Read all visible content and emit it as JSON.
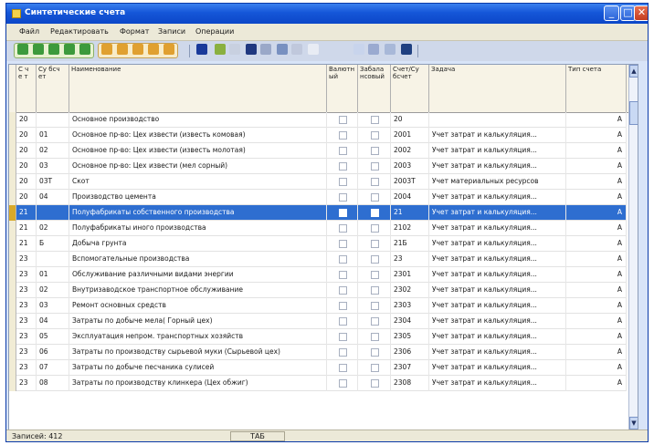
{
  "window": {
    "title": "Синтетические счета",
    "controls": [
      "_",
      "□",
      "✕"
    ]
  },
  "menu": [
    "Файл",
    "Редактировать",
    "Формат",
    "Записи",
    "Операции"
  ],
  "columns": [
    {
      "label": "С ч е т",
      "key": "acct"
    },
    {
      "label": "Су бсч ет",
      "key": "sub"
    },
    {
      "label": "Наименование",
      "key": "name"
    },
    {
      "label": "Валютн ый",
      "key": "val"
    },
    {
      "label": "Забала нсовый",
      "key": "off"
    },
    {
      "label": "Счет/Су бсчет",
      "key": "code"
    },
    {
      "label": "Задача",
      "key": "task"
    },
    {
      "label": "Тип счета",
      "key": "type"
    }
  ],
  "rows": [
    {
      "acct": "20",
      "sub": "",
      "name": "Основное производство",
      "code": "20",
      "task": "",
      "type": "А"
    },
    {
      "acct": "20",
      "sub": "01",
      "name": "Основное пр-во: Цех извести (известь комовая)",
      "code": "2001",
      "task": "Учет затрат и калькуляция...",
      "type": "А"
    },
    {
      "acct": "20",
      "sub": "02",
      "name": "Основное пр-во: Цех извести (известь молотая)",
      "code": "2002",
      "task": "Учет затрат и калькуляция...",
      "type": "А"
    },
    {
      "acct": "20",
      "sub": "03",
      "name": "Основное пр-во: Цех извести (мел сорный)",
      "code": "2003",
      "task": "Учет затрат и калькуляция...",
      "type": "А"
    },
    {
      "acct": "20",
      "sub": "03Т",
      "name": "Скот",
      "code": "2003Т",
      "task": "Учет материальных ресурсов",
      "type": "А"
    },
    {
      "acct": "20",
      "sub": "04",
      "name": "Производство цемента",
      "code": "2004",
      "task": "Учет затрат и калькуляция...",
      "type": "А"
    },
    {
      "acct": "21",
      "sub": "",
      "name": "Полуфабрикаты собственного производства",
      "code": "21",
      "task": "Учет затрат и калькуляция...",
      "type": "А",
      "selected": true
    },
    {
      "acct": "21",
      "sub": "02",
      "name": "Полуфабрикаты иного производства",
      "code": "2102",
      "task": "Учет затрат и калькуляция...",
      "type": "А"
    },
    {
      "acct": "21",
      "sub": "Б",
      "name": "Добыча грунта",
      "code": "21Б",
      "task": "Учет затрат и калькуляция...",
      "type": "А"
    },
    {
      "acct": "23",
      "sub": "",
      "name": "Вспомогательные производства",
      "code": "23",
      "task": "Учет затрат и калькуляция...",
      "type": "А"
    },
    {
      "acct": "23",
      "sub": "01",
      "name": "Обслуживание различными видами энергии",
      "code": "2301",
      "task": "Учет затрат и калькуляция...",
      "type": "А"
    },
    {
      "acct": "23",
      "sub": "02",
      "name": "Внутризаводское транспортное обслуживание",
      "code": "2302",
      "task": "Учет затрат и калькуляция...",
      "type": "А"
    },
    {
      "acct": "23",
      "sub": "03",
      "name": "Ремонт основных средств",
      "code": "2303",
      "task": "Учет затрат и калькуляция...",
      "type": "А"
    },
    {
      "acct": "23",
      "sub": "04",
      "name": "Затраты по добыче мела( Горный цех)",
      "code": "2304",
      "task": "Учет затрат и калькуляция...",
      "type": "А"
    },
    {
      "acct": "23",
      "sub": "05",
      "name": "Эксплуатация непром. транспортных хозяйств",
      "code": "2305",
      "task": "Учет затрат и калькуляция...",
      "type": "А"
    },
    {
      "acct": "23",
      "sub": "06",
      "name": "Затраты по производству сырьевой муки (Сырьевой цех)",
      "code": "2306",
      "task": "Учет затрат и калькуляция...",
      "type": "А"
    },
    {
      "acct": "23",
      "sub": "07",
      "name": "Затраты по добыче песчаника сулисей",
      "code": "2307",
      "task": "Учет затрат и калькуляция...",
      "type": "А"
    },
    {
      "acct": "23",
      "sub": "08",
      "name": "Затраты по производству клинкера (Цех обжиг)",
      "code": "2308",
      "task": "Учет затрат и калькуляция...",
      "type": "А"
    }
  ],
  "scrollbar": {
    "up": "▲",
    "down": "▼"
  },
  "status": {
    "records": "Записей: 412",
    "mode": "ТАБ"
  },
  "colors": {
    "title": "#0c47c8",
    "selection": "#2e6ed0",
    "header": "#f7f3e6"
  }
}
